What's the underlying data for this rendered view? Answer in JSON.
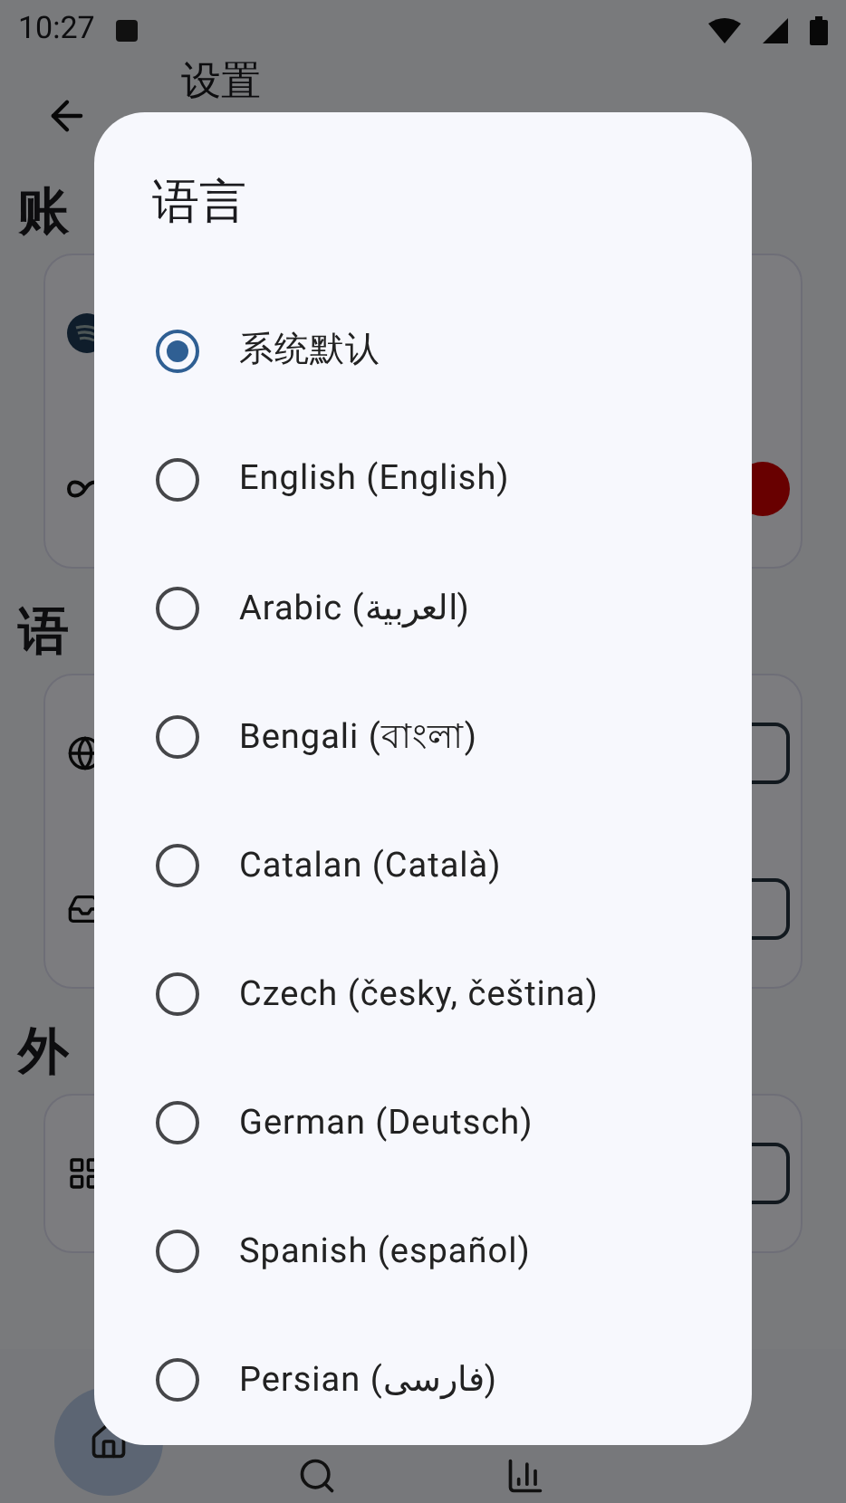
{
  "status_bar": {
    "time": "10:27"
  },
  "app_bar": {
    "title": "设置"
  },
  "sections": [
    {
      "heading": "账",
      "items": [
        {
          "kind": "plain"
        },
        {
          "kind": "button"
        }
      ]
    },
    {
      "heading": "语",
      "items": [
        {
          "kind": "dropdown"
        },
        {
          "kind": "dropdown"
        }
      ]
    },
    {
      "heading": "外",
      "items": [
        {
          "kind": "dropdown"
        }
      ]
    }
  ],
  "bottom_nav": [
    {
      "selected": true
    },
    {
      "selected": false
    },
    {
      "selected": false
    }
  ],
  "dialog": {
    "title": "语言",
    "options": [
      {
        "label": "系统默认",
        "selected": true
      },
      {
        "label": "English (English)",
        "selected": false
      },
      {
        "label": "Arabic (العربية)",
        "selected": false
      },
      {
        "label": "Bengali (বাংলা)",
        "selected": false
      },
      {
        "label": "Catalan (Català)",
        "selected": false
      },
      {
        "label": "Czech (česky, čeština)",
        "selected": false
      },
      {
        "label": "German (Deutsch)",
        "selected": false
      },
      {
        "label": "Spanish (español)",
        "selected": false
      },
      {
        "label": "Persian (فارسی)",
        "selected": false
      }
    ]
  }
}
